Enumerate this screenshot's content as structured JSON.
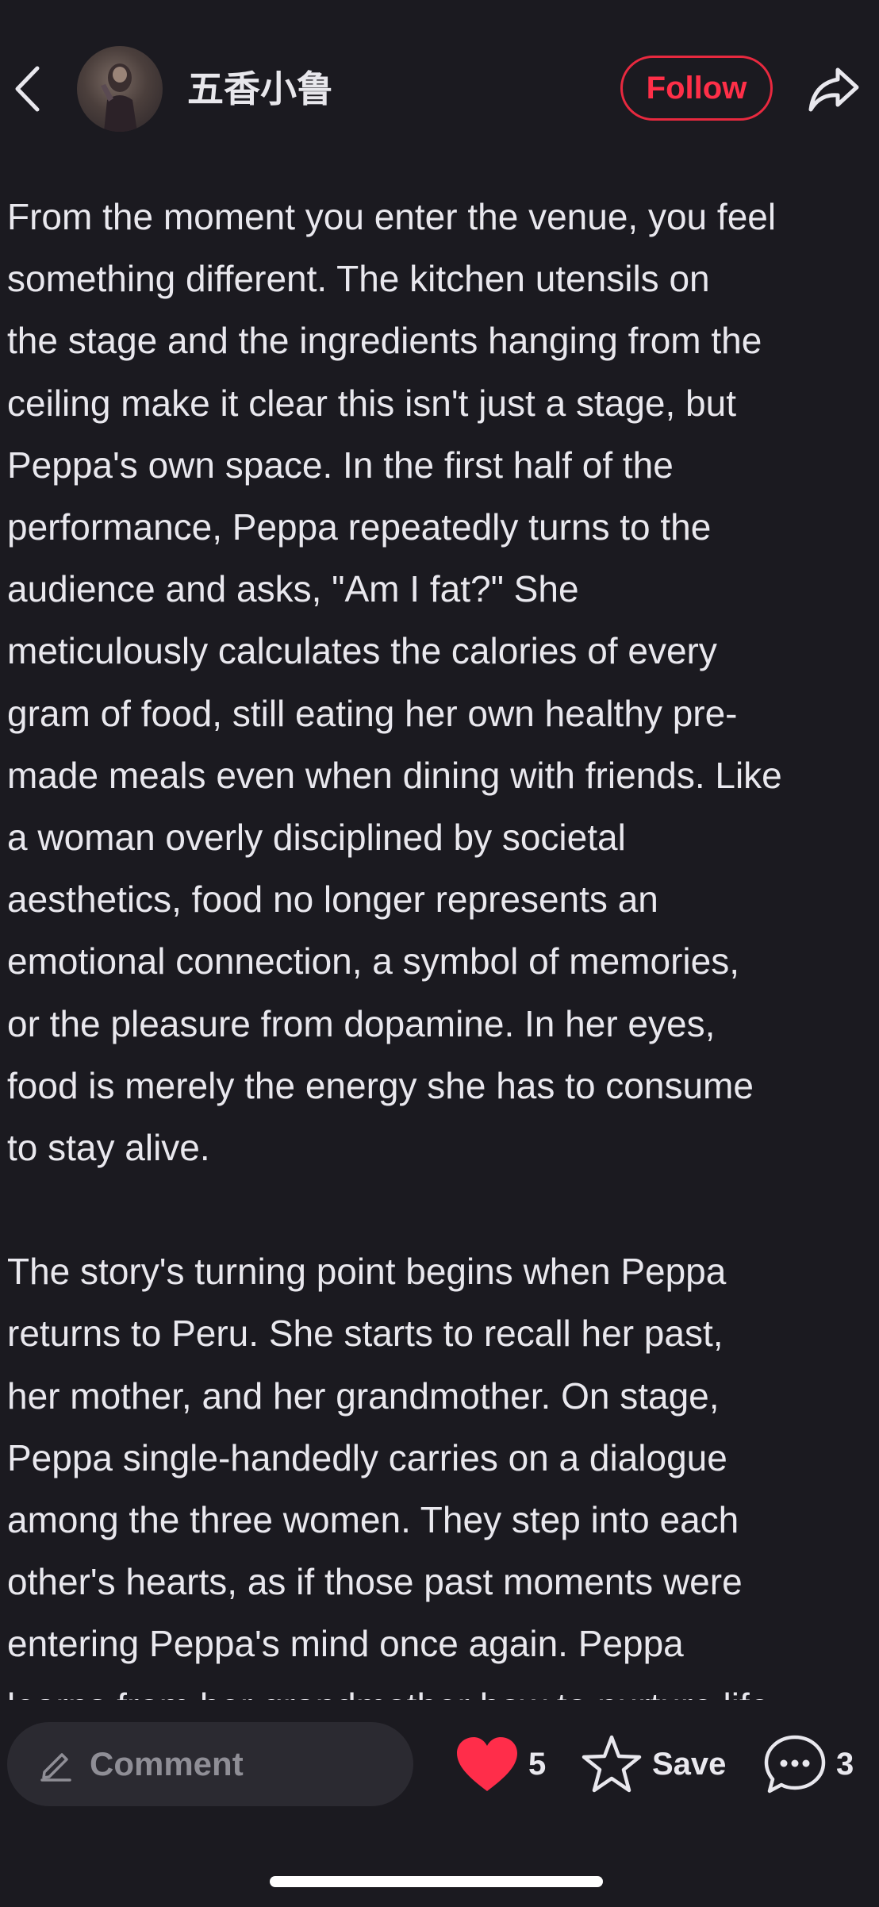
{
  "header": {
    "author_name": "五香小鲁",
    "follow_label": "Follow",
    "icons": {
      "back": "chevron-left-icon",
      "share": "share-arrow-icon",
      "avatar": "user-avatar"
    }
  },
  "post": {
    "paragraphs": [
      "From the moment you enter the venue, you feel\nsomething different. The kitchen utensils on\nthe stage and the ingredients hanging from the\nceiling make it clear this isn't just a stage, but\nPeppa's own space. In the first half of the\nperformance, Peppa repeatedly turns to the\naudience and asks, \"Am I fat?\" She\nmeticulously calculates the calories of every\ngram of food, still eating her own healthy pre-\nmade meals even when dining with friends. Like\na woman overly disciplined by societal\naesthetics, food no longer represents an\nemotional connection, a symbol of memories,\nor the pleasure from dopamine. In her eyes,\nfood is merely the energy she has to consume\nto stay alive.",
      "The story's turning point begins when Peppa\nreturns to Peru. She starts to recall her past,\nher mother, and her grandmother. On stage,\nPeppa single-handedly carries on a dialogue\namong the three women. They step into each\nother's hearts, as if those past moments were\nentering Peppa's mind once again. Peppa\nlearns from her grandmother how to nurture life"
    ]
  },
  "bottom_bar": {
    "comment_placeholder": "Comment",
    "like_count": "5",
    "save_label": "Save",
    "comment_count": "3",
    "colors": {
      "like": "#ff2d4a",
      "follow": "#e8293f",
      "background": "#1b1a20",
      "input_background": "#2b2a31"
    }
  }
}
